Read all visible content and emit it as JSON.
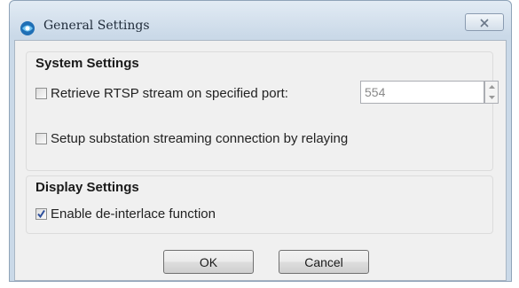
{
  "window": {
    "title": "General Settings"
  },
  "system_settings": {
    "heading": "System Settings",
    "rtsp": {
      "label": "Retrieve RTSP stream on specified port:",
      "checked": false,
      "port_value": "554"
    },
    "relay": {
      "label": "Setup substation streaming connection by relaying",
      "checked": false
    }
  },
  "display_settings": {
    "heading": "Display Settings",
    "deinterlace": {
      "label": "Enable de-interlace function",
      "checked": true
    }
  },
  "buttons": {
    "ok": "OK",
    "cancel": "Cancel"
  },
  "icons": {
    "app": "app-logo-icon",
    "close": "close-icon",
    "spin_up": "spin-up-arrow-icon",
    "spin_down": "spin-down-arrow-icon",
    "check": "checkmark-icon"
  },
  "colors": {
    "frame": "#cad9e8",
    "client": "#f0f0f0",
    "check": "#2b4d9b"
  }
}
